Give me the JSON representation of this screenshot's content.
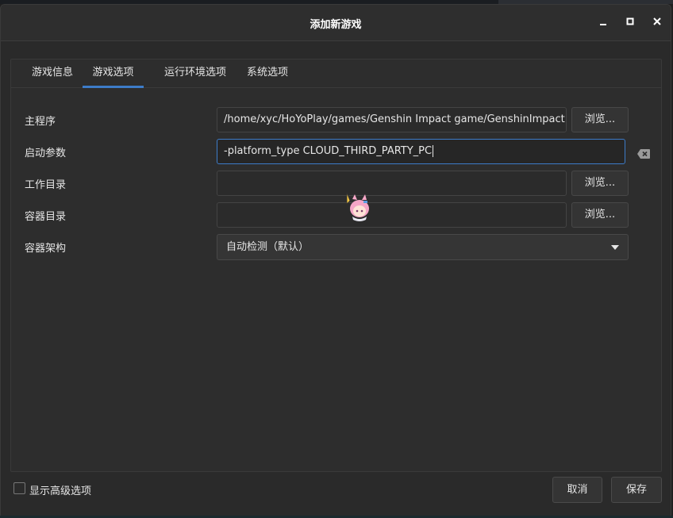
{
  "window": {
    "title": "添加新游戏"
  },
  "tabs": [
    {
      "label": "游戏信息",
      "active": false
    },
    {
      "label": "游戏选项",
      "active": true
    },
    {
      "label": "运行环境选项",
      "active": false
    },
    {
      "label": "系统选项",
      "active": false
    }
  ],
  "form": {
    "main_program": {
      "label": "主程序",
      "value": "/home/xyc/HoYoPlay/games/Genshin Impact game/GenshinImpact.e",
      "browse_label": "浏览..."
    },
    "launch_args": {
      "label": "启动参数",
      "value": "-platform_type CLOUD_THIRD_PARTY_PC"
    },
    "working_dir": {
      "label": "工作目录",
      "value": "",
      "browse_label": "浏览..."
    },
    "container_dir": {
      "label": "容器目录",
      "value": "",
      "browse_label": "浏览..."
    },
    "container_arch": {
      "label": "容器架构",
      "selected": "自动检测（默认）"
    }
  },
  "footer": {
    "advanced_label": "显示高级选项",
    "advanced_checked": false,
    "cancel_label": "取消",
    "save_label": "保存"
  },
  "colors": {
    "accent": "#3d7cc9",
    "background": "#2a2a2a"
  }
}
